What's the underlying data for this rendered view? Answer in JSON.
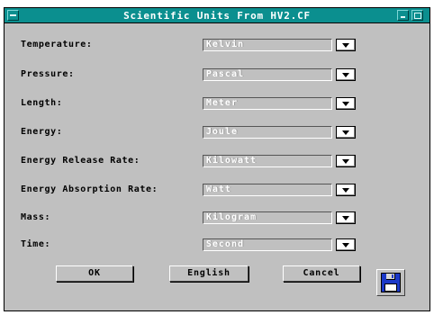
{
  "window": {
    "title": "Scientific Units From HV2.CF"
  },
  "fields": [
    {
      "label": "Temperature:",
      "value": "Kelvin"
    },
    {
      "label": "Pressure:",
      "value": "Pascal"
    },
    {
      "label": "Length:",
      "value": "Meter"
    },
    {
      "label": "Energy:",
      "value": "Joule"
    },
    {
      "label": "Energy Release Rate:",
      "value": "Kilowatt"
    },
    {
      "label": "Energy Absorption Rate:",
      "value": "Watt"
    },
    {
      "label": "Mass:",
      "value": "Kilogram"
    },
    {
      "label": "Time:",
      "value": "Second"
    }
  ],
  "buttons": {
    "ok": "OK",
    "english": "English",
    "cancel": "Cancel"
  },
  "icons": {
    "save": "floppy-disk-icon",
    "sysmenu": "system-menu-icon",
    "minimize": "minimize-icon",
    "maximize": "maximize-icon",
    "dropdown": "chevron-down-icon"
  },
  "colors": {
    "titlebar": "#0b8f8f",
    "dialog": "#c0c0c0",
    "floppy": "#1c39c8"
  }
}
